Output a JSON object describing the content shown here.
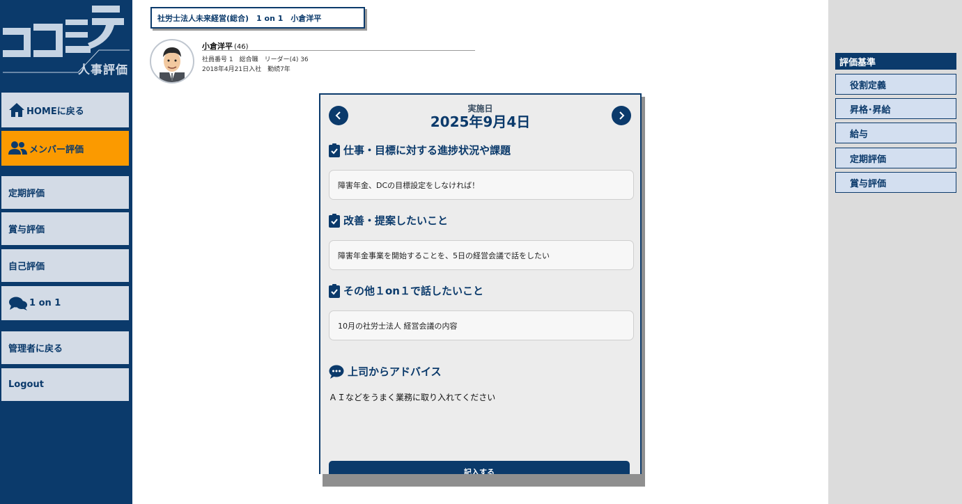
{
  "sidebar": {
    "logo_text": "ココミラ",
    "logo_subtitle": "人事評価",
    "items": [
      {
        "label": "HOMEに戻る",
        "icon": "home-icon"
      },
      {
        "label": "メンバー評価",
        "icon": "users-icon",
        "active": true
      },
      {
        "label": "定期評価"
      },
      {
        "label": "賞与評価"
      },
      {
        "label": "自己評価"
      },
      {
        "label": "1 on 1",
        "icon": "chat-icon"
      },
      {
        "label": "管理者に戻る"
      },
      {
        "label": "Logout"
      }
    ]
  },
  "header": {
    "org_title": "社労士法人未来経営(総合)　1 on 1　小倉洋平"
  },
  "profile": {
    "name": "小倉洋平",
    "age": "(46)",
    "info_line1": "社員番号 1　総合職　リーダー(4) 36",
    "info_line2": "2018年4月21日入社　勤続7年"
  },
  "card": {
    "date_label": "実施日",
    "date_value": "2025年9月4日",
    "sections": [
      {
        "title": "仕事・目標に対する進捗状況や課題",
        "answer": "障害年金、DCの目標設定をしなければ！"
      },
      {
        "title": "改善・提案したいこと",
        "answer": "障害年金事業を開始することを、5日の経営会議で話をしたい"
      },
      {
        "title": "その他１on１で話したいこと",
        "answer": "10月の社労士法人 経営会議の内容"
      }
    ],
    "advice_title": "上司からアドバイス",
    "advice_text": "ＡＩなどをうまく業務に取り入れてください",
    "submit_label": "記入する"
  },
  "right_panel": {
    "heading": "評価基準",
    "items": [
      "役割定義",
      "昇格･昇給",
      "給与",
      "定期評価",
      "賞与評価"
    ]
  },
  "colors": {
    "navy": "#0b3a6b",
    "active_orange": "#fb9a00",
    "nav_button_bg": "#d3dbe6",
    "card_bg": "#ececec"
  }
}
